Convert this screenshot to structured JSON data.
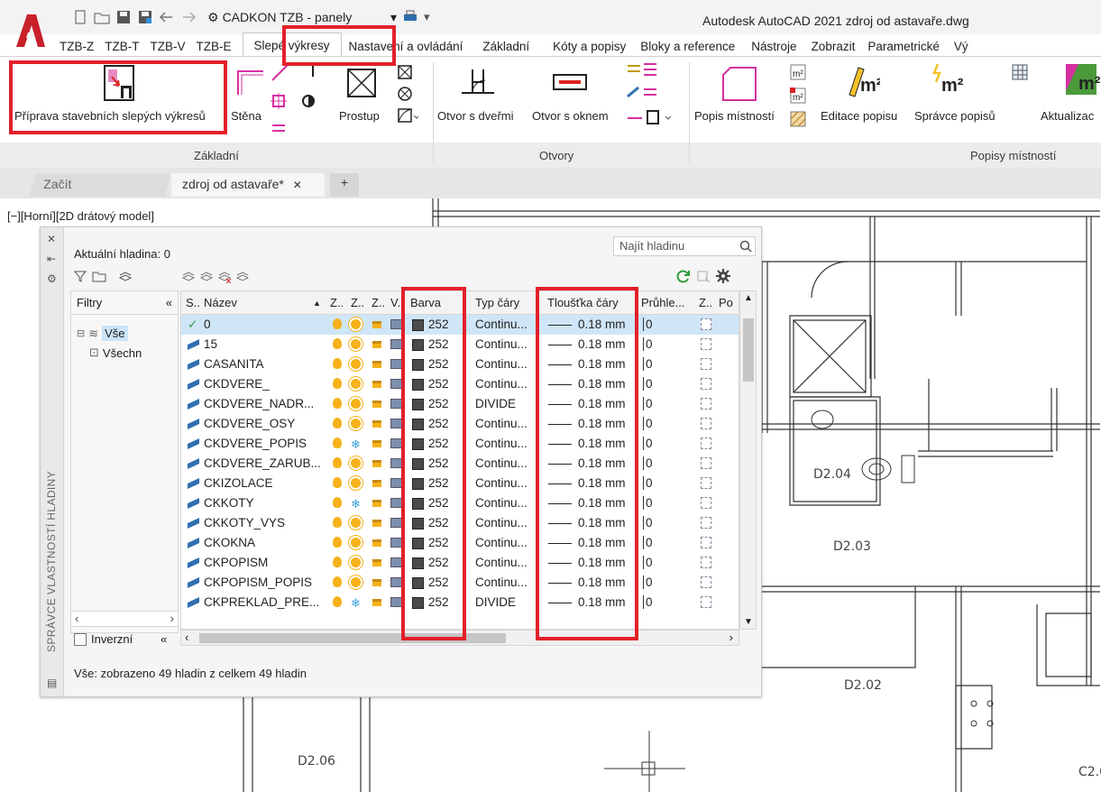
{
  "app": {
    "workspace": "CADKON TZB - panely",
    "title": "Autodesk AutoCAD 2021   zdroj od astavaře.dwg"
  },
  "ribbon": {
    "tabs": [
      {
        "label": "TZB-Z"
      },
      {
        "label": "TZB-T"
      },
      {
        "label": "TZB-V"
      },
      {
        "label": "TZB-E"
      },
      {
        "label": "Slepé výkresy",
        "active": true
      },
      {
        "label": "Nastavení a ovládání"
      },
      {
        "label": "Základní"
      },
      {
        "label": "Kóty a popisy"
      },
      {
        "label": "Bloky a reference"
      },
      {
        "label": "Nástroje"
      },
      {
        "label": "Zobrazit"
      },
      {
        "label": "Parametrické"
      },
      {
        "label": "Vý"
      }
    ],
    "buttons": {
      "priprava": "Příprava stavebních slepých výkresů",
      "stena": "Stěna",
      "prostup": "Prostup",
      "otvor_dvere": "Otvor s dveřmi",
      "otvor_okno": "Otvor s oknem",
      "popis_mistnosti": "Popis místností",
      "editace_popisu": "Editace popisu",
      "spravce_popisu": "Správce popisů",
      "aktualizace": "Aktualizac"
    },
    "panels": {
      "zakladni": "Základní",
      "otvory": "Otvory",
      "popisy": "Popisy místností"
    },
    "m2": "m²"
  },
  "doc_tabs": {
    "start": "Začít",
    "current": "zdroj od astavaře*",
    "close": "✕",
    "plus": "+"
  },
  "viewport_label": "[−][Horní][2D drátový model]",
  "rooms": [
    "D2.04",
    "D2.03",
    "D2.02",
    "D2.06",
    "C2.0"
  ],
  "palette": {
    "side_title": "SPRÁVCE VLASTNOSTÍ HLADINY",
    "current_layer": "Aktuální hladina: 0",
    "search_placeholder": "Najít hladinu",
    "filters_header": "Filtry",
    "collapse": "«",
    "tree_all": "Vše",
    "tree_child": "Všechn",
    "inverse": "Inverzní",
    "status": "Vše: zobrazeno 49 hladin z celkem 49 hladin",
    "columns": {
      "s": "S..",
      "name": "Název",
      "z1": "Z..",
      "z2": "Z..",
      "z3": "Z..",
      "v": "V..",
      "color": "Barva",
      "linetype": "Typ čáry",
      "lineweight": "Tloušťka čáry",
      "transparency": "Průhle...",
      "z4": "Z..",
      "po": "Po"
    },
    "rows": [
      {
        "status": "✓",
        "name": "0",
        "freeze": "sun",
        "color": "252",
        "linetype": "Continu...",
        "lineweight": "0.18 mm",
        "transparency": "0",
        "selected": true
      },
      {
        "status": "",
        "name": "15",
        "freeze": "sun",
        "color": "252",
        "linetype": "Continu...",
        "lineweight": "0.18 mm",
        "transparency": "0"
      },
      {
        "status": "",
        "name": "CASANITA",
        "freeze": "sun",
        "color": "252",
        "linetype": "Continu...",
        "lineweight": "0.18 mm",
        "transparency": "0"
      },
      {
        "status": "",
        "name": "CKDVERE_",
        "freeze": "sun",
        "color": "252",
        "linetype": "Continu...",
        "lineweight": "0.18 mm",
        "transparency": "0"
      },
      {
        "status": "",
        "name": "CKDVERE_NADR...",
        "freeze": "sun",
        "color": "252",
        "linetype": "DIVIDE",
        "lineweight": "0.18 mm",
        "transparency": "0"
      },
      {
        "status": "",
        "name": "CKDVERE_OSY",
        "freeze": "sun",
        "color": "252",
        "linetype": "Continu...",
        "lineweight": "0.18 mm",
        "transparency": "0"
      },
      {
        "status": "",
        "name": "CKDVERE_POPIS",
        "freeze": "snow",
        "color": "252",
        "linetype": "Continu...",
        "lineweight": "0.18 mm",
        "transparency": "0"
      },
      {
        "status": "",
        "name": "CKDVERE_ZARUB...",
        "freeze": "sun",
        "color": "252",
        "linetype": "Continu...",
        "lineweight": "0.18 mm",
        "transparency": "0"
      },
      {
        "status": "",
        "name": "CKIZOLACE",
        "freeze": "sun",
        "color": "252",
        "linetype": "Continu...",
        "lineweight": "0.18 mm",
        "transparency": "0"
      },
      {
        "status": "",
        "name": "CKKOTY",
        "freeze": "snow",
        "color": "252",
        "linetype": "Continu...",
        "lineweight": "0.18 mm",
        "transparency": "0"
      },
      {
        "status": "",
        "name": "CKKOTY_VYS",
        "freeze": "sun",
        "color": "252",
        "linetype": "Continu...",
        "lineweight": "0.18 mm",
        "transparency": "0"
      },
      {
        "status": "",
        "name": "CKOKNA",
        "freeze": "sun",
        "color": "252",
        "linetype": "Continu...",
        "lineweight": "0.18 mm",
        "transparency": "0"
      },
      {
        "status": "",
        "name": "CKPOPISM",
        "freeze": "sun",
        "color": "252",
        "linetype": "Continu...",
        "lineweight": "0.18 mm",
        "transparency": "0"
      },
      {
        "status": "",
        "name": "CKPOPISM_POPIS",
        "freeze": "sun",
        "color": "252",
        "linetype": "Continu...",
        "lineweight": "0.18 mm",
        "transparency": "0"
      },
      {
        "status": "",
        "name": "CKPREKLAD_PRE...",
        "freeze": "snow",
        "color": "252",
        "linetype": "DIVIDE",
        "lineweight": "0.18 mm",
        "transparency": "0"
      }
    ]
  },
  "colors": {
    "highlight": "#e3202b",
    "accent": "#2f8fd8",
    "bulb": "#f6b21a",
    "freeze_snow": "#3aa0d8",
    "selected_row": "#cfe6f8"
  }
}
